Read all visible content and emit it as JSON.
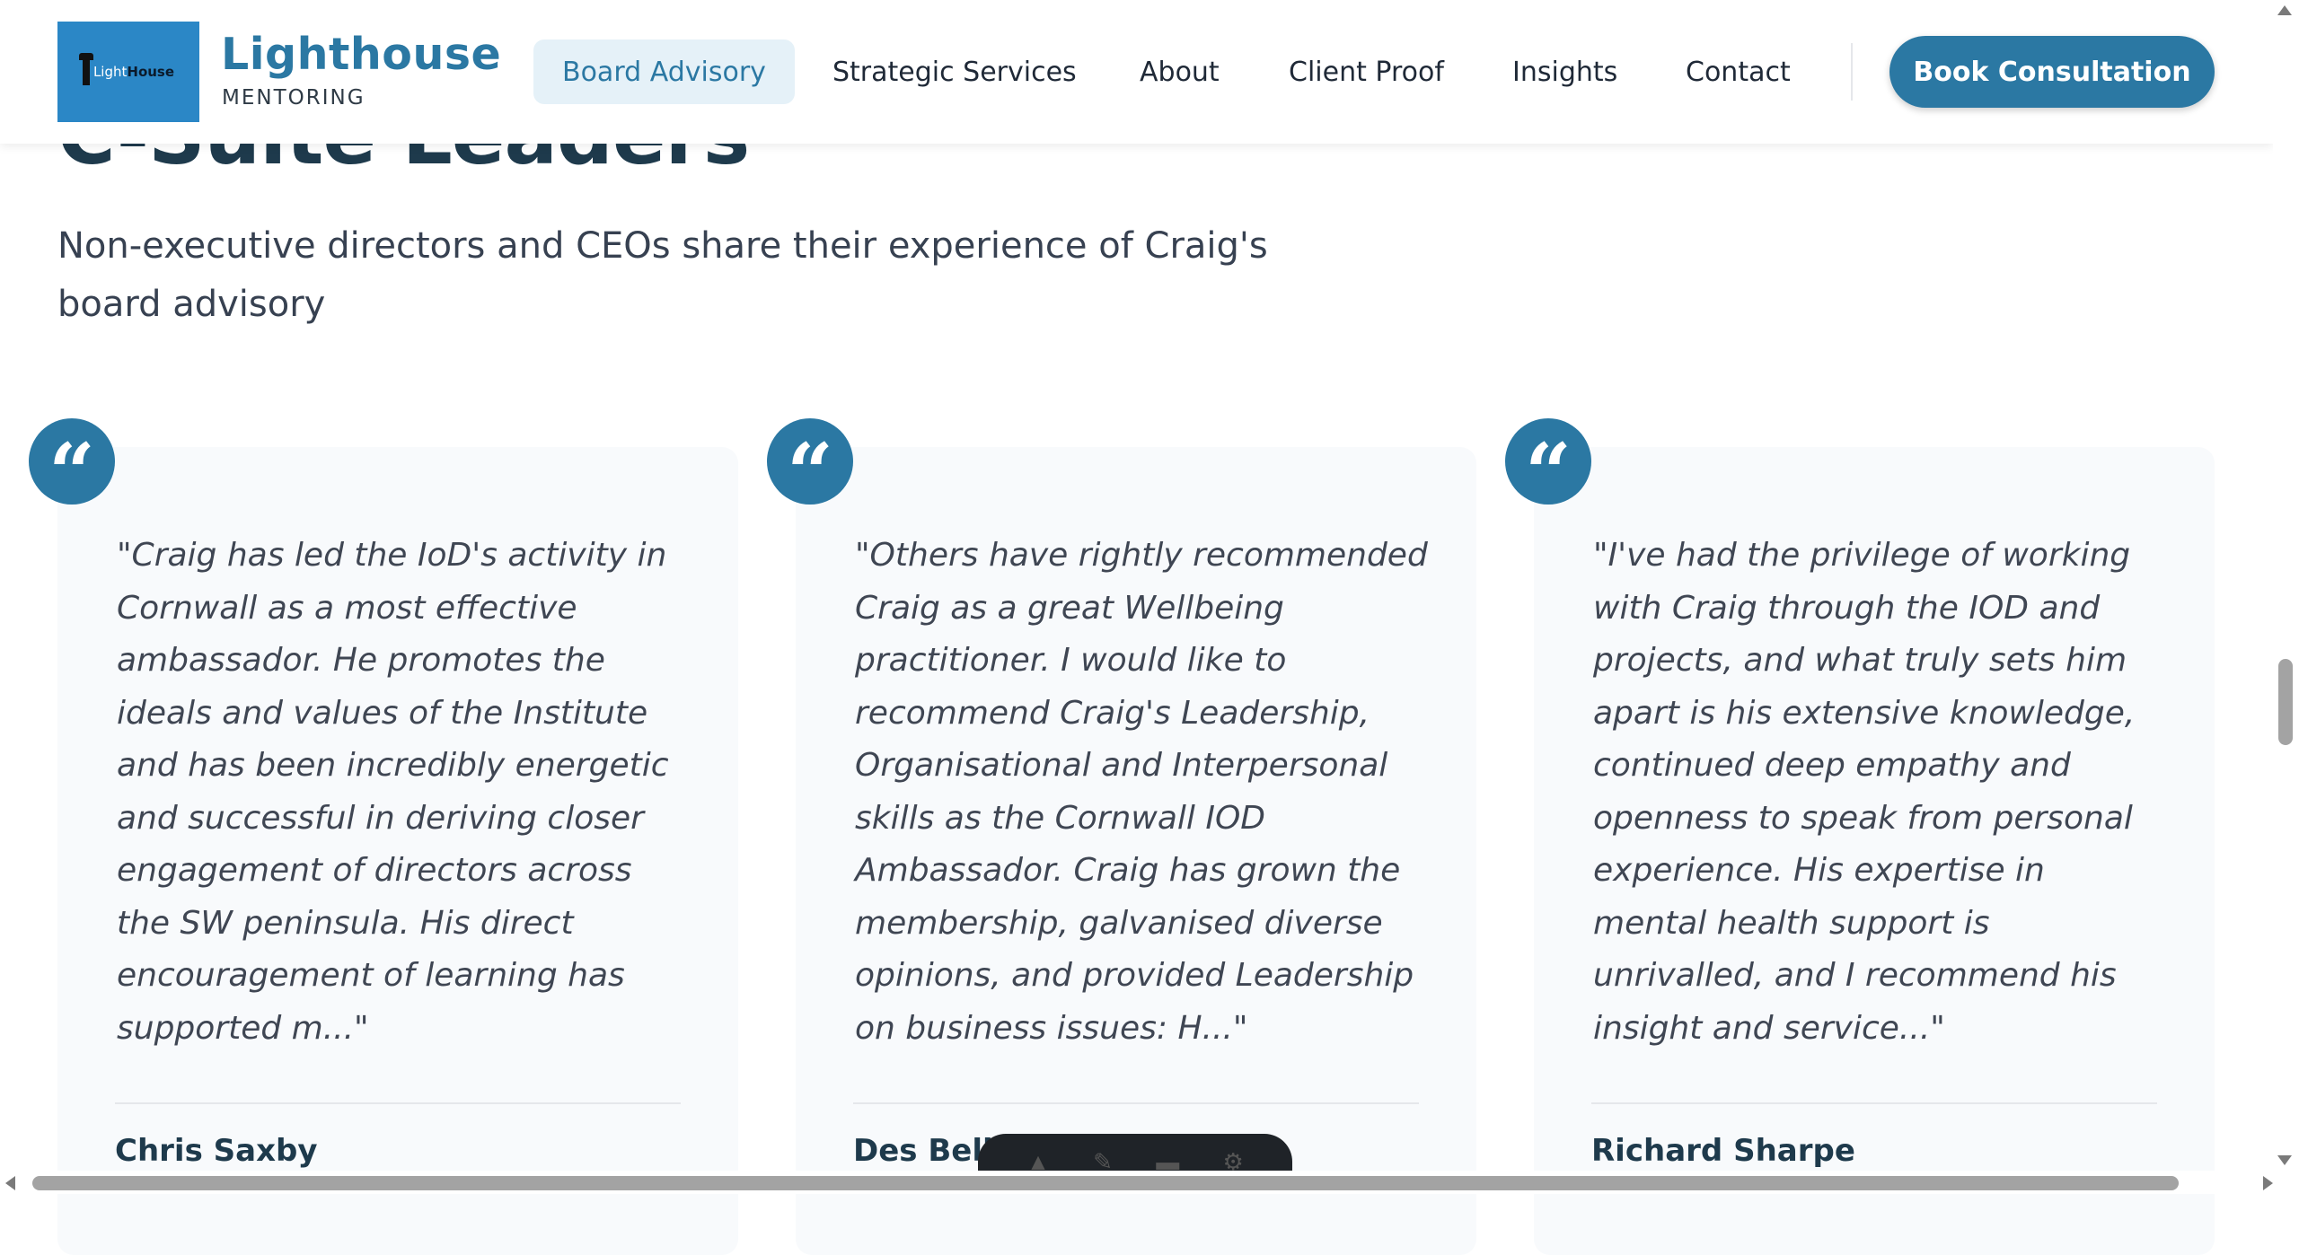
{
  "header": {
    "logo_text_light": "Light",
    "logo_text_bold": "House",
    "brand_name": "Lighthouse",
    "brand_sub": "MENTORING",
    "nav": [
      {
        "label": "Board Advisory",
        "active": true
      },
      {
        "label": "Strategic Services"
      },
      {
        "label": "About"
      },
      {
        "label": "Client Proof"
      },
      {
        "label": "Insights"
      },
      {
        "label": "Contact"
      }
    ],
    "cta_label": "Book Consultation"
  },
  "section": {
    "heading": "C-Suite Leaders",
    "subtitle": "Non-executive directors and CEOs share their experience of Craig's board advisory"
  },
  "testimonials": [
    {
      "quote": "\"Craig has led the IoD's activity in Cornwall as a most effective ambassador. He promotes the ideals and values of the Institute and has been incredibly energetic and successful in deriving closer engagement of directors across the SW peninsula. His direct encouragement of learning has supported m...\"",
      "author": "Chris Saxby"
    },
    {
      "quote": "\"Others have rightly recommended Craig as a great Wellbeing practitioner. I would like to recommend Craig's Leadership, Organisational and Interpersonal skills as the Cornwall IOD Ambassador. Craig has grown the membership, galvanised diverse opinions, and provided Leadership on business issues: H...\"",
      "author": "Des Bell"
    },
    {
      "quote": "\"I've had the privilege of working with Craig through the IOD and projects, and what truly sets him apart is his extensive knowledge, continued deep empathy and openness to speak from personal experience. His expertise in mental health support is unrivalled, and I recommend his insight and service...\"",
      "author": "Richard Sharpe"
    }
  ],
  "quote_glyph": "“",
  "colors": {
    "brand": "#2b78a3",
    "logo_bg": "#2b87c6",
    "nav_active_bg": "#e5f1f8",
    "card_bg": "#f8fafc",
    "heading": "#1e3a4c"
  }
}
